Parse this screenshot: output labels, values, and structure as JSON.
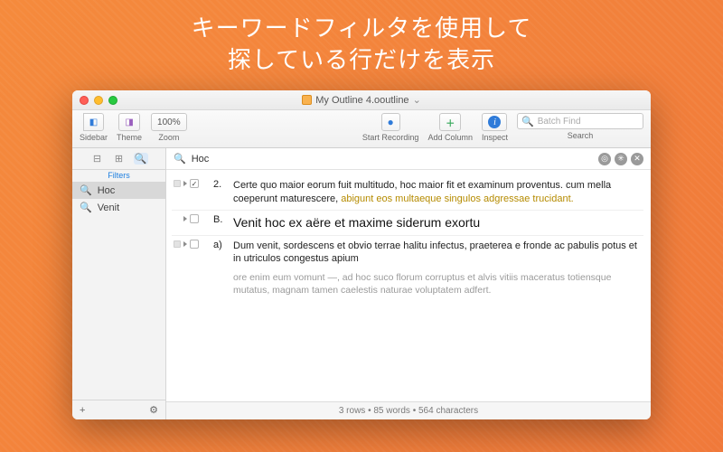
{
  "promo": {
    "line1": "キーワードフィルタを使用して",
    "line2": "探している行だけを表示"
  },
  "window": {
    "title": "My Outline 4.ooutline",
    "title_suffix": "⌄"
  },
  "toolbar": {
    "sidebar_label": "Sidebar",
    "theme_label": "Theme",
    "zoom_label": "Zoom",
    "zoom_value": "100%",
    "start_recording_label": "Start Recording",
    "add_column_label": "Add Column",
    "inspect_label": "Inspect",
    "search_label": "Search",
    "search_placeholder": "Batch Find"
  },
  "sidebar": {
    "section_label": "Filters",
    "items": [
      {
        "label": "Hoc",
        "selected": true
      },
      {
        "label": "Venit",
        "selected": false
      }
    ],
    "add_label": "+",
    "gear_label": "✱"
  },
  "filter": {
    "query": "Hoc"
  },
  "rows": [
    {
      "marker": "2.",
      "checked": true,
      "text_pre": "Certe quo maior eorum fuit multitudo, hoc maior fit et examinum proventus. cum mella coeperunt maturescere, ",
      "text_hl": "abigunt eos multaeque singulos adgressae trucidant.",
      "text_post": "",
      "big": false
    },
    {
      "marker": "B.",
      "checked": false,
      "text_pre": "Venit hoc ex aëre et maxime siderum exortu",
      "text_hl": "",
      "text_post": "",
      "big": true
    },
    {
      "marker": "a)",
      "checked": false,
      "text_pre": "Dum venit, sordescens et obvio terrae halitu infectus, praeterea e fronde ac pabulis potus et in utriculos congestus apium",
      "text_hl": "",
      "text_post": "",
      "note": "ore enim eum vomunt —, ad hoc suco florum corruptus et alvis vitiis maceratus totiensque mutatus, magnam tamen caelestis naturae voluptatem adfert.",
      "big": false
    }
  ],
  "status": {
    "text": "3 rows • 85 words • 564 characters"
  }
}
